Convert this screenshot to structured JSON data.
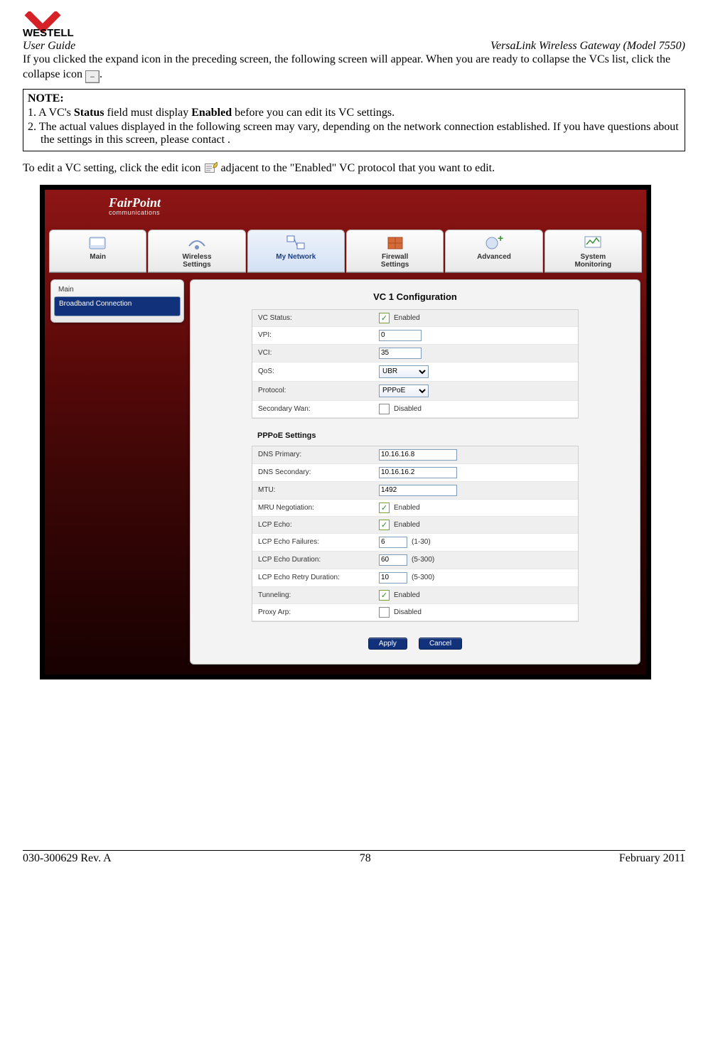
{
  "brand": "WESTELL",
  "header": {
    "left": "User Guide",
    "right": "VersaLink Wireless Gateway (Model 7550)"
  },
  "para1a": "If you clicked the expand icon in the preceding screen, the following screen will appear. When you are ready to collapse the VCs list, click the collapse icon ",
  "para1b": ".",
  "note": {
    "title": "NOTE:",
    "item1_pre": "1. A VC's ",
    "item1_b1": "Status",
    "item1_mid": " field must display ",
    "item1_b2": "Enabled",
    "item1_post": " before you can edit its VC settings.",
    "item2": "2. The actual values displayed in the following screen may vary, depending on the network connection established. If you have questions about the settings in this screen, please contact ."
  },
  "para2a": "To edit a VC setting, click the edit icon ",
  "para2b": " adjacent to the \"Enabled\" VC protocol that you want to edit.",
  "ui": {
    "brand1": "FairPoint",
    "brand2": "communications",
    "nav": [
      "Main",
      "Wireless\nSettings",
      "My Network",
      "Firewall\nSettings",
      "Advanced",
      "System\nMonitoring"
    ],
    "sidebar": [
      "Main",
      "Broadband Connection"
    ],
    "panel_title": "VC 1 Configuration",
    "rows": {
      "vc_status_l": "VC Status:",
      "vc_status_t": "Enabled",
      "vpi_l": "VPI:",
      "vpi_v": "0",
      "vci_l": "VCI:",
      "vci_v": "35",
      "qos_l": "QoS:",
      "qos_v": "UBR",
      "proto_l": "Protocol:",
      "proto_v": "PPPoE",
      "sec_l": "Secondary Wan:",
      "sec_t": "Disabled"
    },
    "pppoe_header": "PPPoE Settings",
    "pppoe": {
      "dns1_l": "DNS Primary:",
      "dns1_v": "10.16.16.8",
      "dns2_l": "DNS Secondary:",
      "dns2_v": "10.16.16.2",
      "mtu_l": "MTU:",
      "mtu_v": "1492",
      "mru_l": "MRU Negotiation:",
      "mru_t": "Enabled",
      "lcp_l": "LCP Echo:",
      "lcp_t": "Enabled",
      "lcpf_l": "LCP Echo Failures:",
      "lcpf_v": "6",
      "lcpf_r": "(1-30)",
      "lcpd_l": "LCP Echo Duration:",
      "lcpd_v": "60",
      "lcpd_r": "(5-300)",
      "lcpr_l": "LCP Echo Retry Duration:",
      "lcpr_v": "10",
      "lcpr_r": "(5-300)",
      "tun_l": "Tunneling:",
      "tun_t": "Enabled",
      "parp_l": "Proxy Arp:",
      "parp_t": "Disabled"
    },
    "apply": "Apply",
    "cancel": "Cancel"
  },
  "footer": {
    "left": "030-300629 Rev. A",
    "center": "78",
    "right": "February 2011"
  }
}
